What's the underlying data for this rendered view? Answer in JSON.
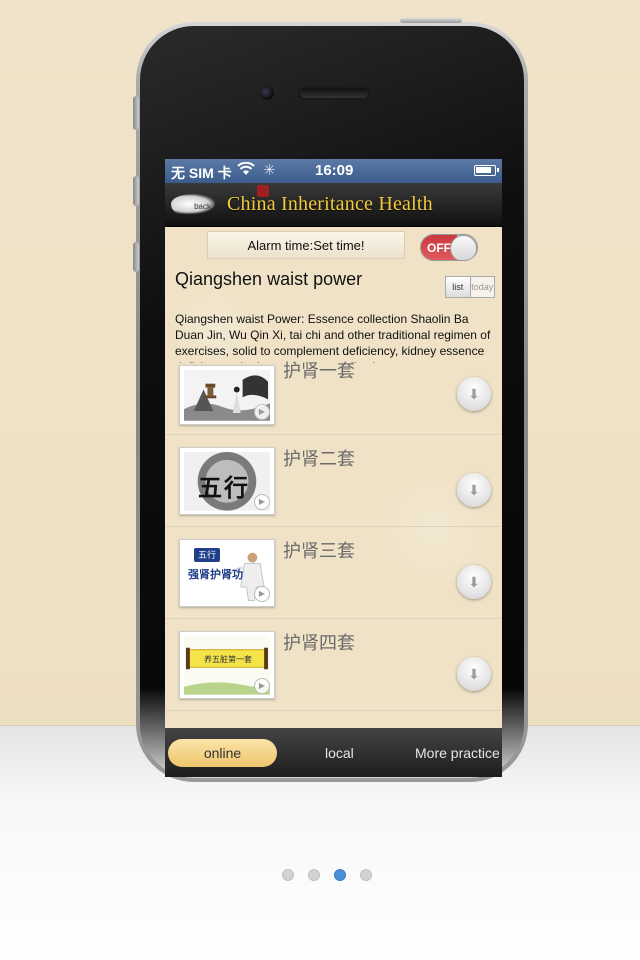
{
  "status_bar": {
    "carrier": "无 SIM 卡",
    "time": "16:09"
  },
  "nav": {
    "back_label": "back",
    "title": "China Inheritance Health"
  },
  "alarm": {
    "label": "Alarm time:Set time!",
    "toggle_label": "OFF"
  },
  "program": {
    "title": "Qiangshen waist power",
    "view_list": "list",
    "view_today": "today",
    "description": "Qiangshen waist Power: Essence collection Shaolin Ba Duan Jin, Wu Qin Xi, tai chi and other traditional regimen of exercises, solid to complement deficiency, kidney essence deficiency who have significant effect!"
  },
  "items": [
    {
      "title": "护肾一套",
      "icon": "download-icon"
    },
    {
      "title": "护肾二套",
      "icon": "download-icon"
    },
    {
      "title": "护肾三套",
      "icon": "download-icon"
    },
    {
      "title": "护肾四套",
      "icon": "download-icon"
    }
  ],
  "thumb_text": {
    "wuxing": "五行",
    "item3_badge": "五行",
    "item3_caption": "强肾护肾功",
    "item4_scroll": "养五脏第一套"
  },
  "tabs": {
    "online": "online",
    "local": "local",
    "more": "More practice"
  },
  "pager": {
    "count": 4,
    "active_index": 2
  },
  "colors": {
    "accent_gold": "#f4cc3a",
    "active_tab": "#eec76d",
    "toggle_off": "#c9393d",
    "active_dot": "#4a8fd6"
  }
}
